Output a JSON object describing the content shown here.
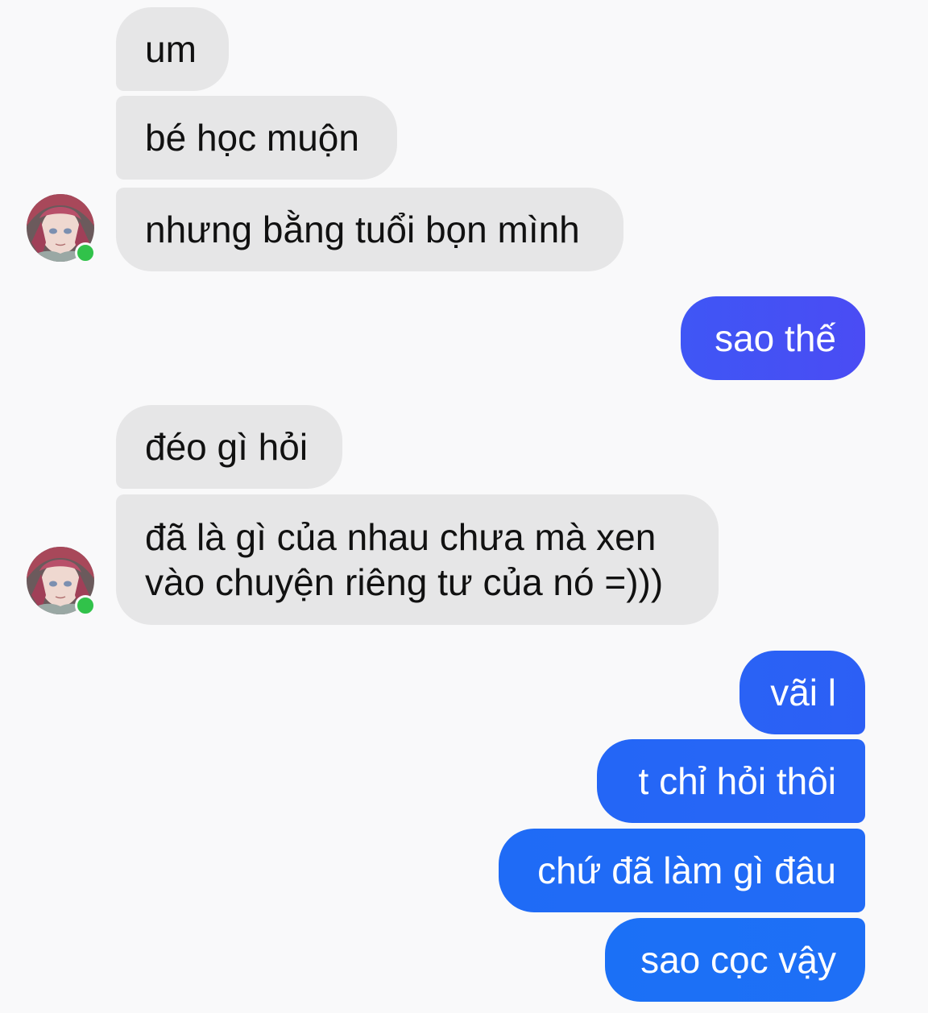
{
  "colors": {
    "incoming_bubble": "#e6e6e7",
    "outgoing_gradient_top": "#4a4cf4",
    "outgoing_bubble": "#1f6cf6",
    "online": "#31c24a",
    "background": "#f9f9fa"
  },
  "messages": [
    {
      "from": "them",
      "text": "um"
    },
    {
      "from": "them",
      "text": "bé học muộn"
    },
    {
      "from": "them",
      "text": "nhưng bằng tuổi bọn mình"
    },
    {
      "from": "me",
      "text": "sao thế"
    },
    {
      "from": "them",
      "text": "đéo gì hỏi"
    },
    {
      "from": "them",
      "lines": [
        "đã là gì của nhau chưa mà xen",
        "vào chuyện riêng tư của nó =)))"
      ]
    },
    {
      "from": "me",
      "text": "vãi l"
    },
    {
      "from": "me",
      "text": "t chỉ hỏi thôi"
    },
    {
      "from": "me",
      "text": "chứ đã làm gì đâu"
    },
    {
      "from": "me",
      "text": "sao cọc vậy"
    }
  ],
  "avatar": {
    "icon": "anime-avatar-icon",
    "status": "online"
  }
}
